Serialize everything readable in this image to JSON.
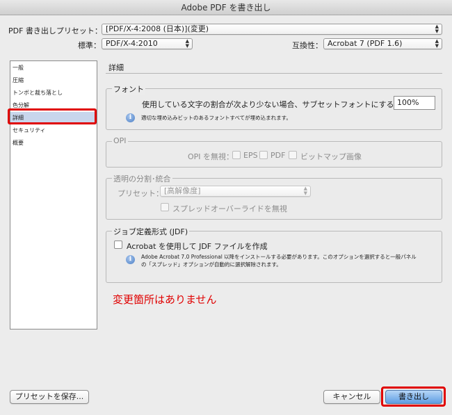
{
  "window": {
    "title": "Adobe PDF を書き出し"
  },
  "preset": {
    "label": "PDF 書き出しプリセット：",
    "value": "[PDF/X-4:2008 (日本)](変更)"
  },
  "standard": {
    "label": "標準：",
    "value": "PDF/X-4:2010"
  },
  "compat": {
    "label": "互換性：",
    "value": "Acrobat 7 (PDF 1.6)"
  },
  "sidebar": {
    "items": [
      {
        "label": "一般"
      },
      {
        "label": "圧縮"
      },
      {
        "label": "トンボと裁ち落とし"
      },
      {
        "label": "色分解"
      },
      {
        "label": "詳細"
      },
      {
        "label": "セキュリティ"
      },
      {
        "label": "概要"
      }
    ],
    "selected_index": 4
  },
  "section": {
    "title": "詳細"
  },
  "fonts": {
    "group_label": "フォント",
    "subset_label": "使用している文字の割合が次より少ない場合、サブセットフォントにする：",
    "subset_value": "100%",
    "info": "適切な埋め込みビットのあるフォントすべてが埋め込まれます。"
  },
  "opi": {
    "group_label": "OPI",
    "omit_label": "OPI を無視：",
    "eps": "EPS",
    "pdf": "PDF",
    "bitmap": "ビットマップ画像"
  },
  "flatten": {
    "group_label": "透明の分割･統合",
    "preset_label": "プリセット：",
    "preset_value": "[高解像度]",
    "override_label": "スプレッドオーバーライドを無視"
  },
  "jdf": {
    "group_label": "ジョブ定義形式 (JDF)",
    "create_label": "Acrobat を使用して JDF ファイルを作成",
    "info_line1": "Adobe Acrobat 7.0 Professional 以降をインストールする必要があります。このオプションを選択すると一般パネル",
    "info_line2": "の「スプレッド」オプションが自動的に選択解除されます。"
  },
  "annotation": {
    "text": "変更箇所はありません",
    "color": "#e00000"
  },
  "buttons": {
    "save_preset": "プリセットを保存...",
    "cancel": "キャンセル",
    "export": "書き出し"
  },
  "icons": {
    "info": "info-icon",
    "dropdown": "updown-arrows-icon"
  }
}
